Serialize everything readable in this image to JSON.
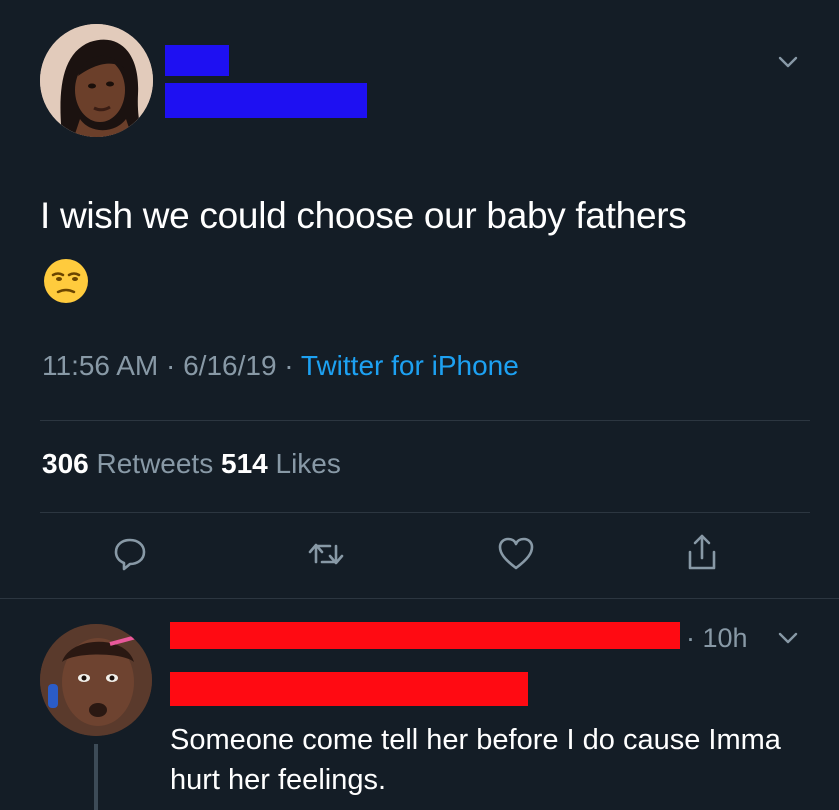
{
  "tweet": {
    "text": "I wish we could choose our baby fathers",
    "emoji": "unamused-face",
    "meta_time_date": "11:56 AM · 6/16/19 · ",
    "meta_source": "Twitter for iPhone",
    "retweets_count": "306",
    "retweets_label": " Retweets ",
    "likes_count": "514",
    "likes_label": " Likes"
  },
  "reply": {
    "time": "· 10h",
    "text": "Someone come tell her before I do cause Imma hurt her feelings."
  },
  "icons": {
    "reply": "comment-icon",
    "retweet": "retweet-icon",
    "like": "heart-icon",
    "share": "share-icon",
    "caret": "chevron-down-icon"
  },
  "colors": {
    "background": "#141d26",
    "secondary_text": "#8899a6",
    "link": "#1da1f2",
    "redaction_blue": "#1e10f2",
    "redaction_red": "#ff0a12"
  }
}
